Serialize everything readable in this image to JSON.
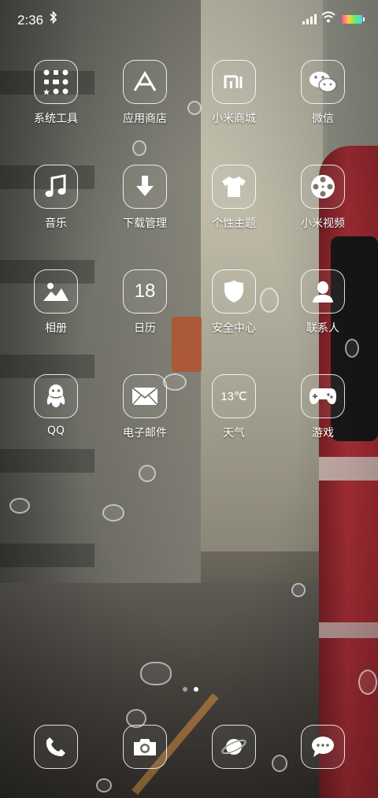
{
  "status_bar": {
    "time": "2:36",
    "bluetooth_icon": "bluetooth-icon",
    "signal_icon": "signal-icon",
    "wifi_icon": "wifi-icon",
    "battery_icon": "battery-icon"
  },
  "apps": [
    {
      "label": "系统工具",
      "icon": "folder-grid-icon"
    },
    {
      "label": "应用商店",
      "icon": "app-store-icon"
    },
    {
      "label": "小米商城",
      "icon": "mi-logo-icon"
    },
    {
      "label": "微信",
      "icon": "wechat-icon"
    },
    {
      "label": "音乐",
      "icon": "music-note-icon"
    },
    {
      "label": "下载管理",
      "icon": "download-arrow-icon"
    },
    {
      "label": "个性主题",
      "icon": "tshirt-icon"
    },
    {
      "label": "小米视频",
      "icon": "film-reel-icon"
    },
    {
      "label": "相册",
      "icon": "photo-mountain-icon"
    },
    {
      "label": "日历",
      "icon": "calendar-icon",
      "icon_text": "18"
    },
    {
      "label": "安全中心",
      "icon": "shield-icon"
    },
    {
      "label": "联系人",
      "icon": "person-icon"
    },
    {
      "label": "QQ",
      "icon": "qq-penguin-icon"
    },
    {
      "label": "电子邮件",
      "icon": "envelope-icon"
    },
    {
      "label": "天气",
      "icon": "weather-icon",
      "icon_text": "13℃"
    },
    {
      "label": "游戏",
      "icon": "gamepad-icon"
    }
  ],
  "page_indicator": {
    "pages": 2,
    "active": 1
  },
  "dock": [
    {
      "icon": "phone-icon"
    },
    {
      "icon": "camera-icon"
    },
    {
      "icon": "browser-planet-icon"
    },
    {
      "icon": "message-bubble-icon"
    }
  ]
}
